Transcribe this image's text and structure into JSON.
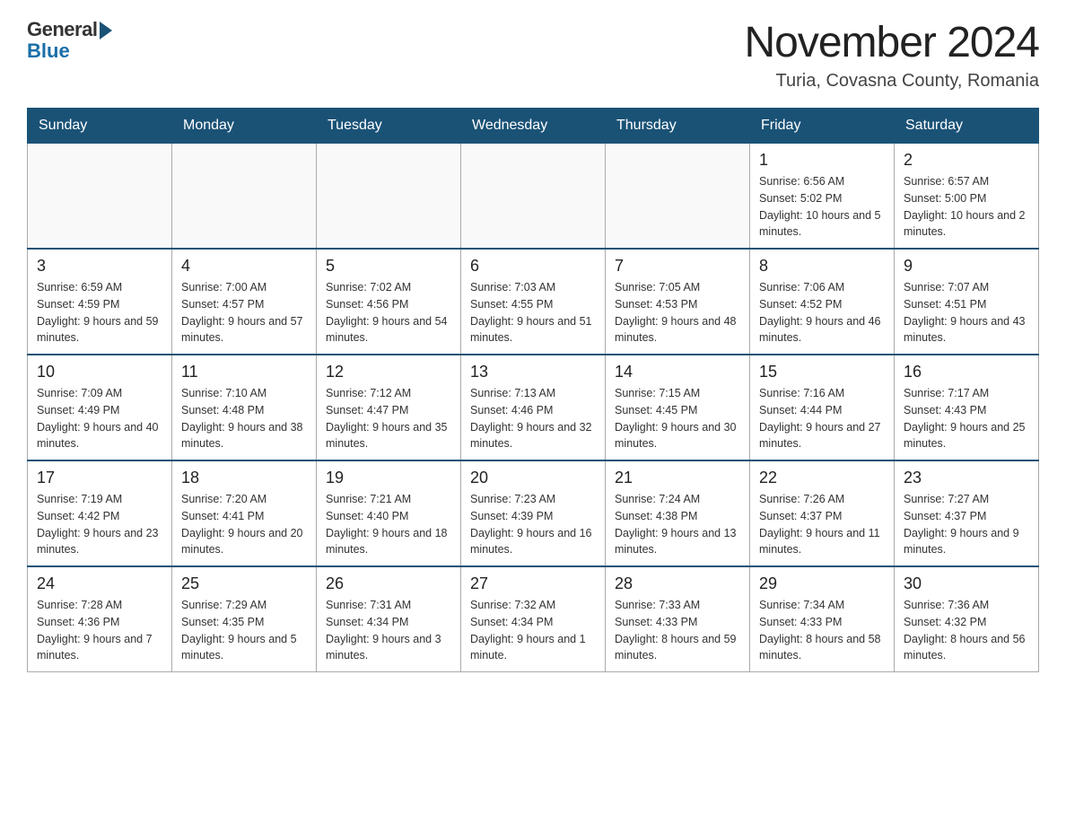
{
  "header": {
    "logo_general": "General",
    "logo_blue": "Blue",
    "month_title": "November 2024",
    "location": "Turia, Covasna County, Romania"
  },
  "days_of_week": [
    "Sunday",
    "Monday",
    "Tuesday",
    "Wednesday",
    "Thursday",
    "Friday",
    "Saturday"
  ],
  "weeks": [
    [
      {
        "day": "",
        "info": ""
      },
      {
        "day": "",
        "info": ""
      },
      {
        "day": "",
        "info": ""
      },
      {
        "day": "",
        "info": ""
      },
      {
        "day": "",
        "info": ""
      },
      {
        "day": "1",
        "info": "Sunrise: 6:56 AM\nSunset: 5:02 PM\nDaylight: 10 hours and 5 minutes."
      },
      {
        "day": "2",
        "info": "Sunrise: 6:57 AM\nSunset: 5:00 PM\nDaylight: 10 hours and 2 minutes."
      }
    ],
    [
      {
        "day": "3",
        "info": "Sunrise: 6:59 AM\nSunset: 4:59 PM\nDaylight: 9 hours and 59 minutes."
      },
      {
        "day": "4",
        "info": "Sunrise: 7:00 AM\nSunset: 4:57 PM\nDaylight: 9 hours and 57 minutes."
      },
      {
        "day": "5",
        "info": "Sunrise: 7:02 AM\nSunset: 4:56 PM\nDaylight: 9 hours and 54 minutes."
      },
      {
        "day": "6",
        "info": "Sunrise: 7:03 AM\nSunset: 4:55 PM\nDaylight: 9 hours and 51 minutes."
      },
      {
        "day": "7",
        "info": "Sunrise: 7:05 AM\nSunset: 4:53 PM\nDaylight: 9 hours and 48 minutes."
      },
      {
        "day": "8",
        "info": "Sunrise: 7:06 AM\nSunset: 4:52 PM\nDaylight: 9 hours and 46 minutes."
      },
      {
        "day": "9",
        "info": "Sunrise: 7:07 AM\nSunset: 4:51 PM\nDaylight: 9 hours and 43 minutes."
      }
    ],
    [
      {
        "day": "10",
        "info": "Sunrise: 7:09 AM\nSunset: 4:49 PM\nDaylight: 9 hours and 40 minutes."
      },
      {
        "day": "11",
        "info": "Sunrise: 7:10 AM\nSunset: 4:48 PM\nDaylight: 9 hours and 38 minutes."
      },
      {
        "day": "12",
        "info": "Sunrise: 7:12 AM\nSunset: 4:47 PM\nDaylight: 9 hours and 35 minutes."
      },
      {
        "day": "13",
        "info": "Sunrise: 7:13 AM\nSunset: 4:46 PM\nDaylight: 9 hours and 32 minutes."
      },
      {
        "day": "14",
        "info": "Sunrise: 7:15 AM\nSunset: 4:45 PM\nDaylight: 9 hours and 30 minutes."
      },
      {
        "day": "15",
        "info": "Sunrise: 7:16 AM\nSunset: 4:44 PM\nDaylight: 9 hours and 27 minutes."
      },
      {
        "day": "16",
        "info": "Sunrise: 7:17 AM\nSunset: 4:43 PM\nDaylight: 9 hours and 25 minutes."
      }
    ],
    [
      {
        "day": "17",
        "info": "Sunrise: 7:19 AM\nSunset: 4:42 PM\nDaylight: 9 hours and 23 minutes."
      },
      {
        "day": "18",
        "info": "Sunrise: 7:20 AM\nSunset: 4:41 PM\nDaylight: 9 hours and 20 minutes."
      },
      {
        "day": "19",
        "info": "Sunrise: 7:21 AM\nSunset: 4:40 PM\nDaylight: 9 hours and 18 minutes."
      },
      {
        "day": "20",
        "info": "Sunrise: 7:23 AM\nSunset: 4:39 PM\nDaylight: 9 hours and 16 minutes."
      },
      {
        "day": "21",
        "info": "Sunrise: 7:24 AM\nSunset: 4:38 PM\nDaylight: 9 hours and 13 minutes."
      },
      {
        "day": "22",
        "info": "Sunrise: 7:26 AM\nSunset: 4:37 PM\nDaylight: 9 hours and 11 minutes."
      },
      {
        "day": "23",
        "info": "Sunrise: 7:27 AM\nSunset: 4:37 PM\nDaylight: 9 hours and 9 minutes."
      }
    ],
    [
      {
        "day": "24",
        "info": "Sunrise: 7:28 AM\nSunset: 4:36 PM\nDaylight: 9 hours and 7 minutes."
      },
      {
        "day": "25",
        "info": "Sunrise: 7:29 AM\nSunset: 4:35 PM\nDaylight: 9 hours and 5 minutes."
      },
      {
        "day": "26",
        "info": "Sunrise: 7:31 AM\nSunset: 4:34 PM\nDaylight: 9 hours and 3 minutes."
      },
      {
        "day": "27",
        "info": "Sunrise: 7:32 AM\nSunset: 4:34 PM\nDaylight: 9 hours and 1 minute."
      },
      {
        "day": "28",
        "info": "Sunrise: 7:33 AM\nSunset: 4:33 PM\nDaylight: 8 hours and 59 minutes."
      },
      {
        "day": "29",
        "info": "Sunrise: 7:34 AM\nSunset: 4:33 PM\nDaylight: 8 hours and 58 minutes."
      },
      {
        "day": "30",
        "info": "Sunrise: 7:36 AM\nSunset: 4:32 PM\nDaylight: 8 hours and 56 minutes."
      }
    ]
  ]
}
